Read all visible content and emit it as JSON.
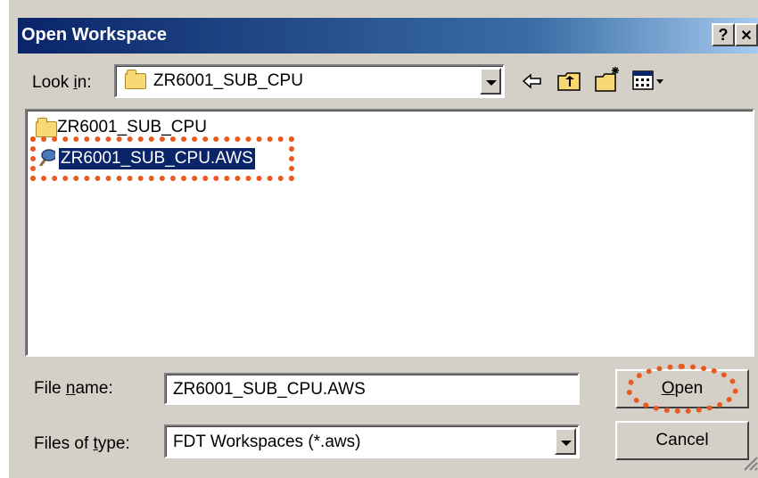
{
  "window": {
    "title": "Open Workspace",
    "help_label": "?",
    "close_label": "✕"
  },
  "look_in": {
    "label_pre": "Look ",
    "label_key": "i",
    "label_post": "n:",
    "value": "ZR6001_SUB_CPU"
  },
  "toolbar": {
    "icons": [
      "back-icon",
      "up-folder-icon",
      "new-folder-icon",
      "view-menu-icon"
    ]
  },
  "files": [
    {
      "name": "ZR6001_SUB_CPU",
      "icon": "folder-icon",
      "selected": false
    },
    {
      "name": "ZR6001_SUB_CPU.AWS",
      "icon": "workspace-file-icon",
      "selected": true
    }
  ],
  "file_name": {
    "label_pre": "File ",
    "label_key": "n",
    "label_post": "ame:",
    "value": "ZR6001_SUB_CPU.AWS"
  },
  "file_type": {
    "label_pre": "Files of ",
    "label_key": "t",
    "label_post": "ype:",
    "value": "FDT Workspaces (*.aws)"
  },
  "buttons": {
    "open_key": "O",
    "open_rest": "pen",
    "cancel": "Cancel"
  },
  "colors": {
    "title_start": "#0a246a",
    "selection": "#0a246a",
    "highlight_outline": "#ea5a1e",
    "face": "#d4d0c8"
  }
}
